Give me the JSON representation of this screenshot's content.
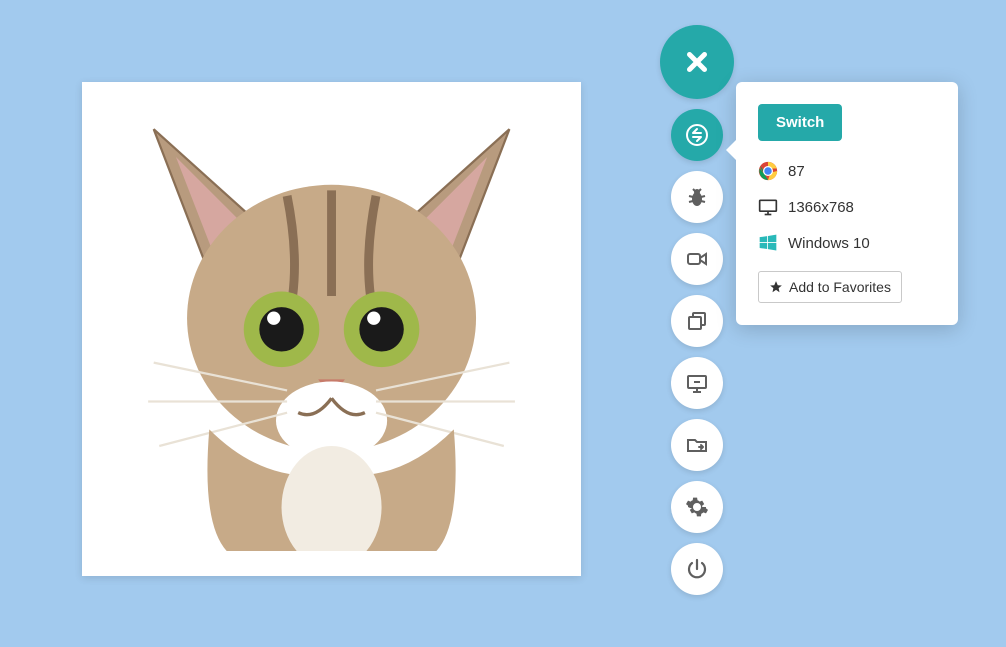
{
  "popover": {
    "switch_label": "Switch",
    "browser_version": "87",
    "resolution": "1366x768",
    "os": "Windows 10",
    "favorites_label": "Add to Favorites"
  },
  "toolbar": {
    "close": "close",
    "switch": "switch",
    "bug": "bug",
    "record": "record",
    "screenshot": "screenshot",
    "devtools": "devtools",
    "files": "files",
    "settings": "settings",
    "power": "power"
  },
  "colors": {
    "bg": "#a2caee",
    "accent": "#25a9a9"
  }
}
